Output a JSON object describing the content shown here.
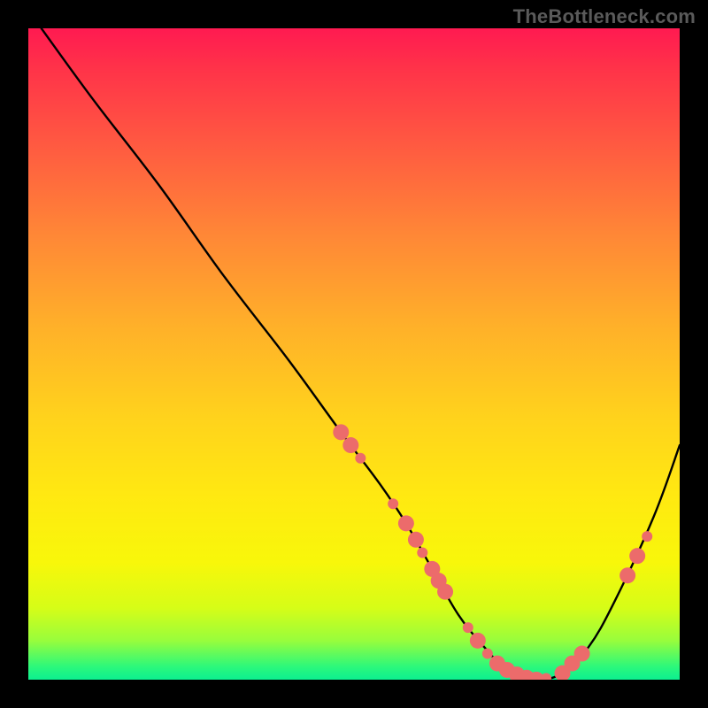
{
  "watermark": "TheBottleneck.com",
  "chart_data": {
    "type": "line",
    "title": "",
    "xlabel": "",
    "ylabel": "",
    "xlim": [
      0,
      100
    ],
    "ylim": [
      0,
      100
    ],
    "grid": false,
    "legend": false,
    "series": [
      {
        "name": "bottleneck-curve",
        "color": "#000000",
        "x": [
          2,
          10,
          20,
          30,
          40,
          48,
          54,
          58,
          62,
          66,
          70,
          74,
          78,
          82,
          86,
          90,
          96,
          100
        ],
        "y": [
          100,
          89,
          76,
          62,
          49,
          38,
          30,
          24,
          17,
          10,
          5,
          1,
          0,
          1,
          5,
          12,
          25,
          36
        ]
      }
    ],
    "markers": {
      "name": "highlighted-points",
      "color": "#ec6b6b",
      "radius_large": 9,
      "radius_small": 6,
      "points": [
        {
          "x": 48.0,
          "y": 38.0,
          "r": "large"
        },
        {
          "x": 49.5,
          "y": 36.0,
          "r": "large"
        },
        {
          "x": 51.0,
          "y": 34.0,
          "r": "small"
        },
        {
          "x": 56.0,
          "y": 27.0,
          "r": "small"
        },
        {
          "x": 58.0,
          "y": 24.0,
          "r": "large"
        },
        {
          "x": 59.5,
          "y": 21.5,
          "r": "large"
        },
        {
          "x": 60.5,
          "y": 19.5,
          "r": "small"
        },
        {
          "x": 62.0,
          "y": 17.0,
          "r": "large"
        },
        {
          "x": 63.0,
          "y": 15.2,
          "r": "large"
        },
        {
          "x": 64.0,
          "y": 13.5,
          "r": "large"
        },
        {
          "x": 67.5,
          "y": 8.0,
          "r": "small"
        },
        {
          "x": 69.0,
          "y": 6.0,
          "r": "large"
        },
        {
          "x": 70.5,
          "y": 4.0,
          "r": "small"
        },
        {
          "x": 72.0,
          "y": 2.5,
          "r": "large"
        },
        {
          "x": 73.5,
          "y": 1.5,
          "r": "large"
        },
        {
          "x": 75.0,
          "y": 0.8,
          "r": "large"
        },
        {
          "x": 76.5,
          "y": 0.3,
          "r": "large"
        },
        {
          "x": 78.0,
          "y": 0.0,
          "r": "large"
        },
        {
          "x": 79.5,
          "y": 0.2,
          "r": "small"
        },
        {
          "x": 82.0,
          "y": 1.0,
          "r": "large"
        },
        {
          "x": 83.5,
          "y": 2.5,
          "r": "large"
        },
        {
          "x": 85.0,
          "y": 4.0,
          "r": "large"
        },
        {
          "x": 92.0,
          "y": 16.0,
          "r": "large"
        },
        {
          "x": 93.5,
          "y": 19.0,
          "r": "large"
        },
        {
          "x": 95.0,
          "y": 22.0,
          "r": "small"
        }
      ]
    }
  }
}
